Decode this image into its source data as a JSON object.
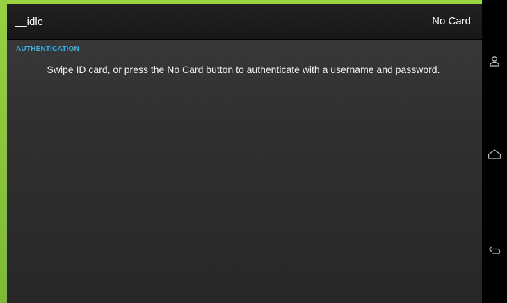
{
  "action_bar": {
    "title": "__idle",
    "no_card_label": "No Card"
  },
  "section": {
    "header": "AUTHENTICATION",
    "instruction": "Swipe ID card, or press the No Card button to authenticate with a username and password."
  },
  "nav_bar": {
    "icons": [
      "person-icon",
      "home-icon",
      "back-icon"
    ]
  },
  "colors": {
    "accent": "#33b5e5",
    "frame": "#8dc63f",
    "action_bar": "#1a1a1a",
    "nav_bar": "#000000"
  }
}
